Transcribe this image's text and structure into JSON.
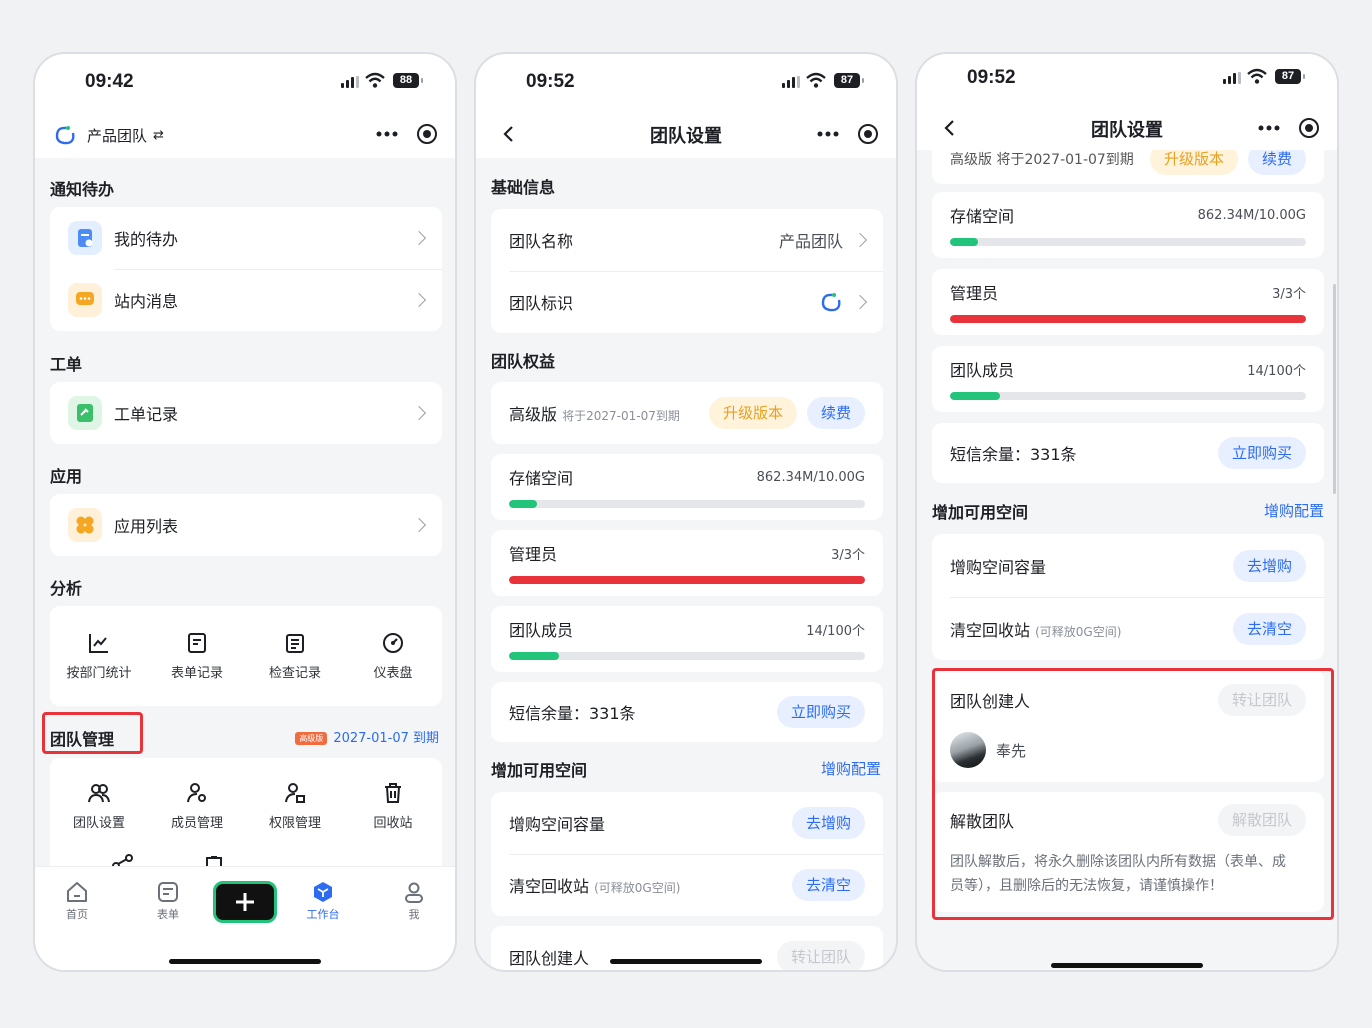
{
  "colors": {
    "accent": "#2d6cf0",
    "danger": "#e8333b",
    "success": "#22c37a",
    "gold": "#e8a021"
  },
  "screen1": {
    "time": "09:42",
    "battery": "88",
    "team_name": "产品团队",
    "switch_glyph": "⇄",
    "sections": {
      "todo": "通知待办",
      "workorder": "工单",
      "apps": "应用",
      "analysis": "分析",
      "team_mgmt": "团队管理"
    },
    "todo_items": [
      {
        "label": "我的待办",
        "icon": "todo-icon"
      },
      {
        "label": "站内消息",
        "icon": "message-icon"
      }
    ],
    "workorder_items": [
      {
        "label": "工单记录",
        "icon": "workorder-icon"
      }
    ],
    "app_items": [
      {
        "label": "应用列表",
        "icon": "app-list-icon"
      }
    ],
    "analysis_items": [
      {
        "label": "按部门统计",
        "icon": "line-chart-icon"
      },
      {
        "label": "表单记录",
        "icon": "form-record-icon"
      },
      {
        "label": "检查记录",
        "icon": "check-record-icon"
      },
      {
        "label": "仪表盘",
        "icon": "dashboard-icon"
      }
    ],
    "plan_badge": "高级版",
    "expiry": "2027-01-07 到期",
    "team_items": [
      {
        "label": "团队设置",
        "icon": "team-settings-icon"
      },
      {
        "label": "成员管理",
        "icon": "member-icon"
      },
      {
        "label": "权限管理",
        "icon": "permission-icon"
      },
      {
        "label": "回收站",
        "icon": "trash-icon"
      }
    ],
    "tabs": [
      {
        "label": "首页",
        "icon": "home-icon"
      },
      {
        "label": "表单",
        "icon": "form-icon"
      },
      {
        "label": "工作台",
        "icon": "workbench-icon"
      },
      {
        "label": "我",
        "icon": "user-icon"
      }
    ]
  },
  "screen2": {
    "time": "09:52",
    "battery": "87",
    "title": "团队设置",
    "basic_section": "基础信息",
    "team_name_label": "团队名称",
    "team_name_value": "产品团队",
    "team_logo_label": "团队标识",
    "rights_section": "团队权益",
    "plan": "高级版",
    "plan_expire": "将于2027-01-07到期",
    "upgrade_btn": "升级版本",
    "renew_btn": "续费",
    "storage_label": "存储空间",
    "storage_value": "862.34M/10.00G",
    "storage_ratio": 0.08,
    "admin_label": "管理员",
    "admin_value": "3/3个",
    "admin_ratio": 1.0,
    "member_label": "团队成员",
    "member_value": "14/100个",
    "member_ratio": 0.14,
    "sms_label": "短信余量：331条",
    "sms_btn": "立即购买",
    "space_section": "增加可用空间",
    "space_config": "增购配置",
    "buy_space_label": "增购空间容量",
    "buy_space_btn": "去增购",
    "clear_label": "清空回收站",
    "clear_note": "(可释放0G空间)",
    "clear_btn": "去清空",
    "creator_label": "团队创建人",
    "transfer_btn": "转让团队"
  },
  "screen3": {
    "time": "09:52",
    "battery": "87",
    "title": "团队设置",
    "partial_plan_row": "高级版 将于2027-01-07到期",
    "partial_upgrade": "升级版本",
    "partial_renew": "续费",
    "storage_label": "存储空间",
    "storage_value": "862.34M/10.00G",
    "storage_ratio": 0.08,
    "admin_label": "管理员",
    "admin_value": "3/3个",
    "admin_ratio": 1.0,
    "member_label": "团队成员",
    "member_value": "14/100个",
    "member_ratio": 0.14,
    "sms_label": "短信余量：331条",
    "sms_btn": "立即购买",
    "space_section": "增加可用空间",
    "space_config": "增购配置",
    "buy_space_label": "增购空间容量",
    "buy_space_btn": "去增购",
    "clear_label": "清空回收站",
    "clear_note": "(可释放0G空间)",
    "clear_btn": "去清空",
    "creator_label": "团队创建人",
    "transfer_btn": "转让团队",
    "creator_name": "奉先",
    "dissolve_label": "解散团队",
    "dissolve_btn": "解散团队",
    "dissolve_warning": "团队解散后，将永久删除该团队内所有数据（表单、成员等），且删除后的无法恢复，请谨慎操作！"
  }
}
